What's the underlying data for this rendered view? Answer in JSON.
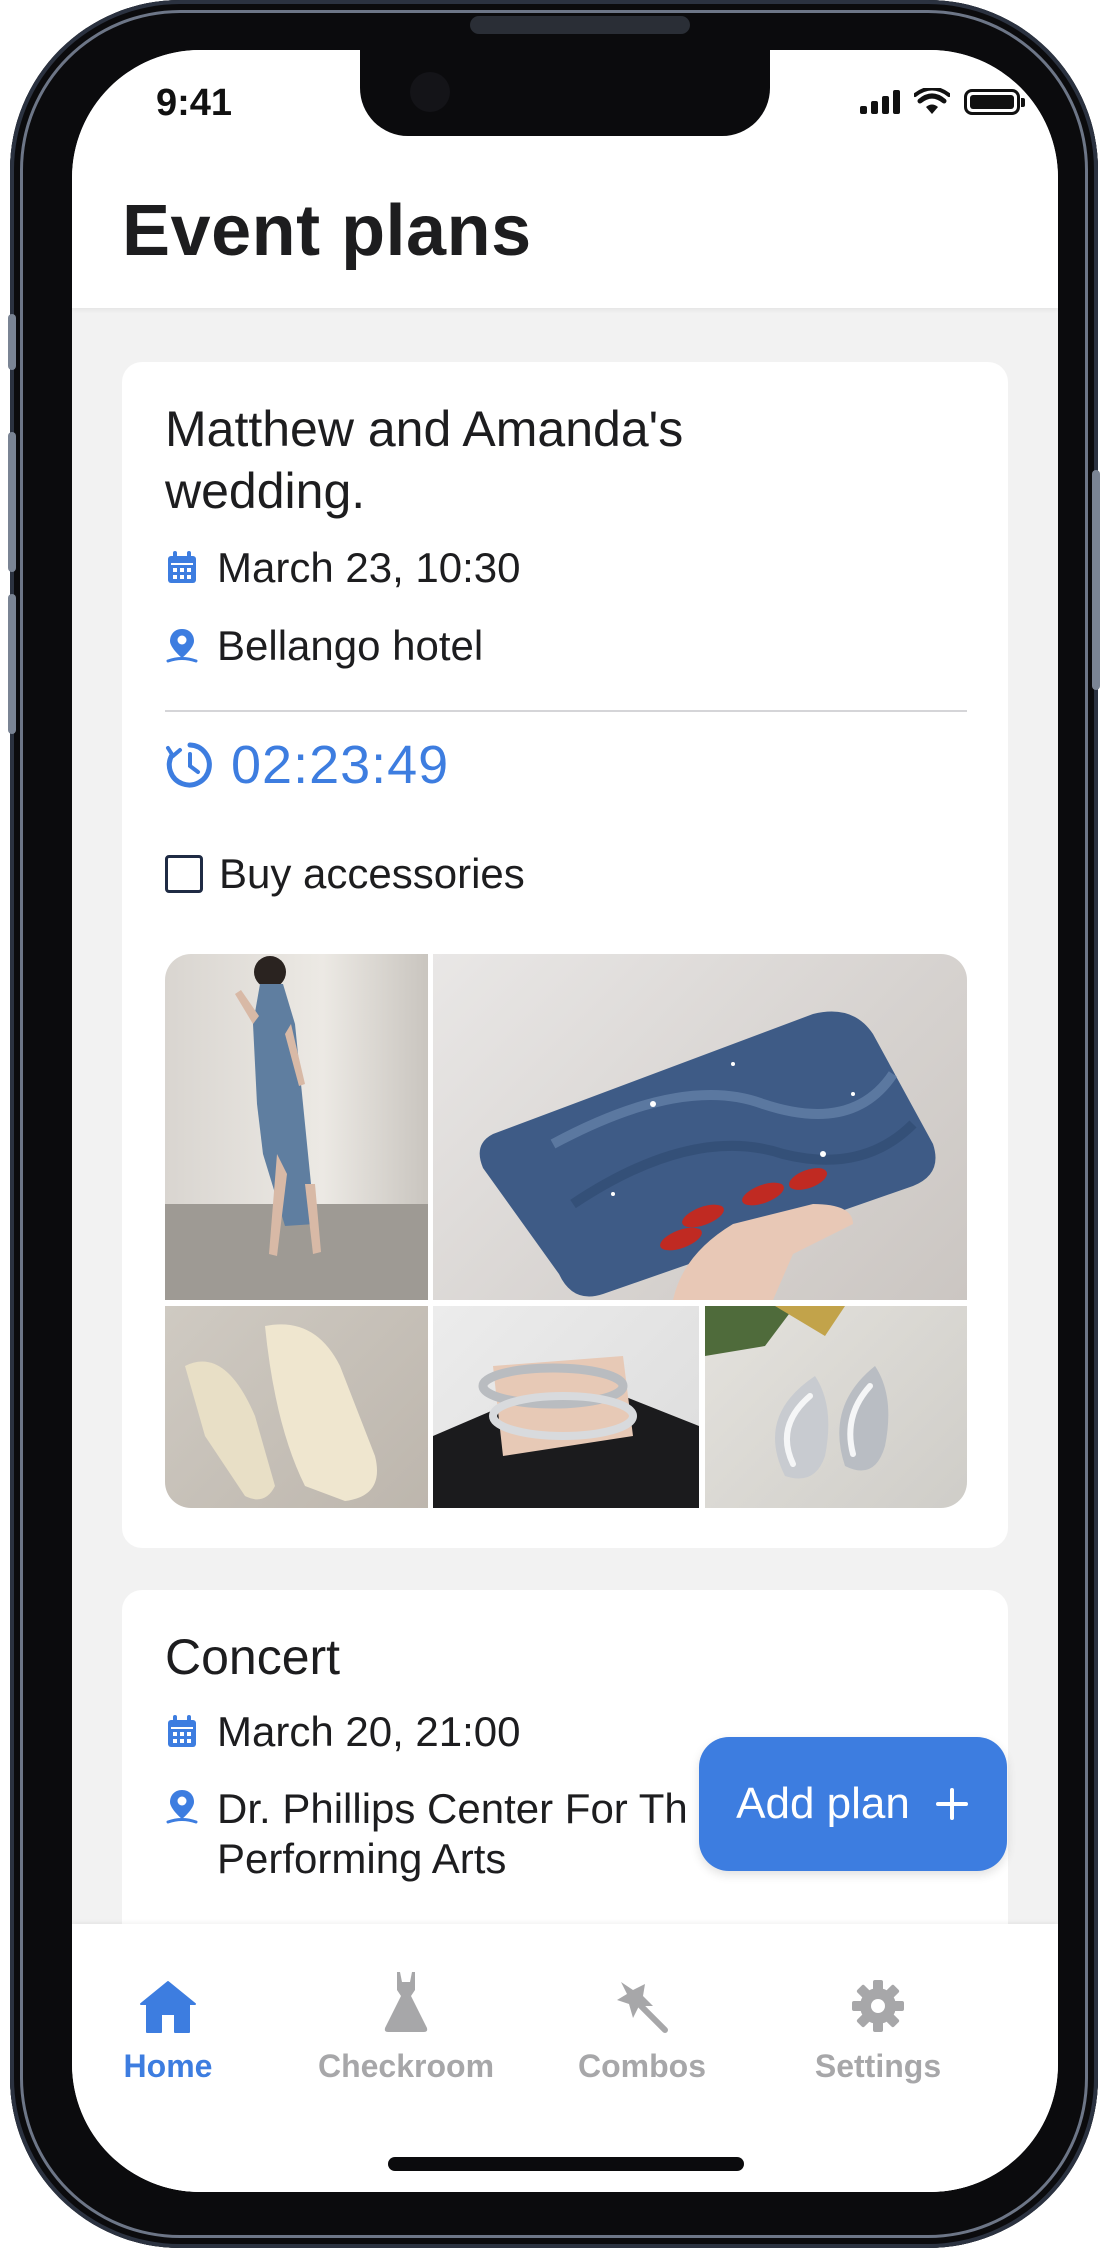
{
  "status_bar": {
    "time": "9:41"
  },
  "header": {
    "title": "Event plans"
  },
  "events": [
    {
      "title": "Matthew and Amanda's wedding.",
      "date": "March 23, 10:30",
      "location": "Bellango hotel",
      "countdown": "02:23:49",
      "task": {
        "label": "Buy accessories",
        "checked": false
      },
      "images": [
        "blue-dress",
        "blue-clutch",
        "cream-heels",
        "silver-bracelets",
        "silver-earrings"
      ]
    },
    {
      "title": "Concert",
      "date": "March 20, 21:00",
      "location_line1": "Dr. Phillips Center For Th",
      "location_line2": "Performing Arts"
    }
  ],
  "fab": {
    "label": "Add plan",
    "icon": "plus-icon"
  },
  "tabbar": {
    "items": [
      {
        "label": "Home",
        "icon": "home-icon",
        "active": true
      },
      {
        "label": "Checkroom",
        "icon": "dress-icon",
        "active": false
      },
      {
        "label": "Combos",
        "icon": "magic-wand-icon",
        "active": false
      },
      {
        "label": "Settings",
        "icon": "gear-icon",
        "active": false
      }
    ]
  },
  "colors": {
    "accent": "#3d7de0",
    "inactive": "#a7a7a9",
    "background": "#f2f2f2",
    "text": "#1d1d1f"
  }
}
